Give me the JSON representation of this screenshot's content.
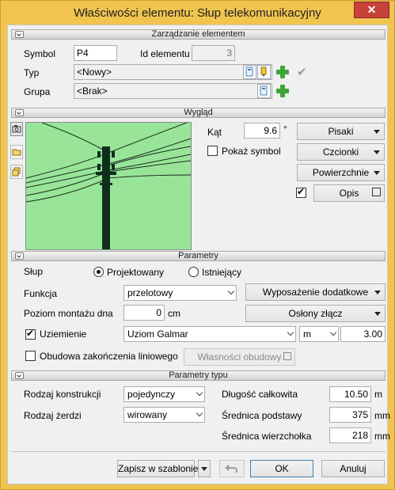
{
  "window": {
    "title": "Właściwości elementu: Słup telekomunikacyjny",
    "close_glyph": "✕"
  },
  "sections": {
    "management": "Zarządzanie elementem",
    "appearance": "Wygląd",
    "parameters": "Parametry",
    "type_parameters": "Parametry typu"
  },
  "management": {
    "symbol_label": "Symbol",
    "symbol_value": "P4",
    "id_label": "Id elementu",
    "id_value": "3",
    "type_label": "Typ",
    "type_value": "<Nowy>",
    "group_label": "Grupa",
    "group_value": "<Brak>"
  },
  "appearance": {
    "angle_label": "Kąt",
    "angle_value": "9.6",
    "angle_unit": "°",
    "show_symbol_label": "Pokaż symbol",
    "show_symbol_checked": false,
    "pens_label": "Pisaki",
    "fonts_label": "Czcionki",
    "surfaces_label": "Powierzchnie",
    "description_label": "Opis",
    "description_checked": true,
    "preview_bg": "#98e59a"
  },
  "parameters": {
    "pole_label": "Słup",
    "designed_label": "Projektowany",
    "existing_label": "Istniejący",
    "function_label": "Funkcja",
    "function_value": "przelotowy",
    "extra_equipment_label": "Wyposażenie dodatkowe",
    "mount_level_label": "Poziom montażu dna",
    "mount_level_value": "0",
    "mount_level_unit": "cm",
    "joint_covers_label": "Osłony złącz",
    "grounding_label": "Uziemienie",
    "grounding_checked": true,
    "grounding_value": "Uziom Galmar",
    "grounding_unit": "m",
    "grounding_length": "3.00",
    "casing_label": "Obudowa zakończenia liniowego",
    "casing_checked": false,
    "casing_props_label": "Własności obudowy"
  },
  "type_parameters": {
    "construction_label": "Rodzaj konstrukcji",
    "construction_value": "pojedynczy",
    "core_label": "Rodzaj żerdzi",
    "core_value": "wirowany",
    "total_length_label": "Długość całkowita",
    "total_length_value": "10.50",
    "total_length_unit": "m",
    "base_diameter_label": "Średnica podstawy",
    "base_diameter_value": "375",
    "base_diameter_unit": "mm",
    "top_diameter_label": "Średnica wierzchołka",
    "top_diameter_value": "218",
    "top_diameter_unit": "mm"
  },
  "footer": {
    "save_template_label": "Zapisz w szablonie",
    "ok_label": "OK",
    "cancel_label": "Anuluj"
  }
}
